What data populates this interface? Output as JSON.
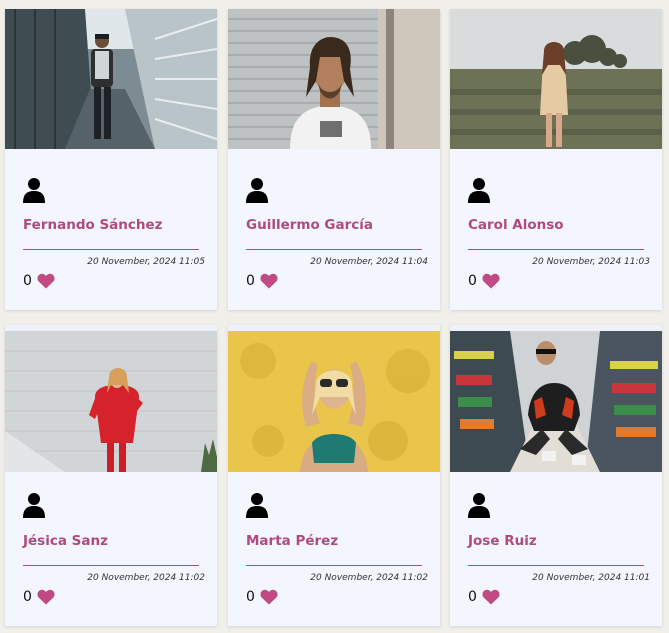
{
  "theme": {
    "accent": "#b04a7f",
    "card_bg": "#f3f5ff",
    "page_bg": "#f1efea"
  },
  "posts": [
    {
      "name": "Fernando Sánchez",
      "date": "20 November, 2024 11:05",
      "likes": "0",
      "photo": "walkway-man-in-jacket",
      "icon": "user-icon"
    },
    {
      "name": "Guillermo García",
      "date": "20 November, 2024 11:04",
      "likes": "0",
      "photo": "man-with-dreadlocks-shutter",
      "icon": "user-icon"
    },
    {
      "name": "Carol Alonso",
      "date": "20 November, 2024 11:03",
      "likes": "0",
      "photo": "woman-in-field",
      "icon": "user-icon"
    },
    {
      "name": "Jésica Sanz",
      "date": "20 November, 2024 11:02",
      "likes": "0",
      "photo": "woman-red-sweater-wall",
      "icon": "user-icon"
    },
    {
      "name": "Marta Pérez",
      "date": "20 November, 2024 11:02",
      "likes": "0",
      "photo": "woman-sunglasses-yellow-wall",
      "icon": "user-icon"
    },
    {
      "name": "Jose Ruiz",
      "date": "20 November, 2024 11:01",
      "likes": "0",
      "photo": "man-crouching-supermarket",
      "icon": "user-icon"
    }
  ]
}
